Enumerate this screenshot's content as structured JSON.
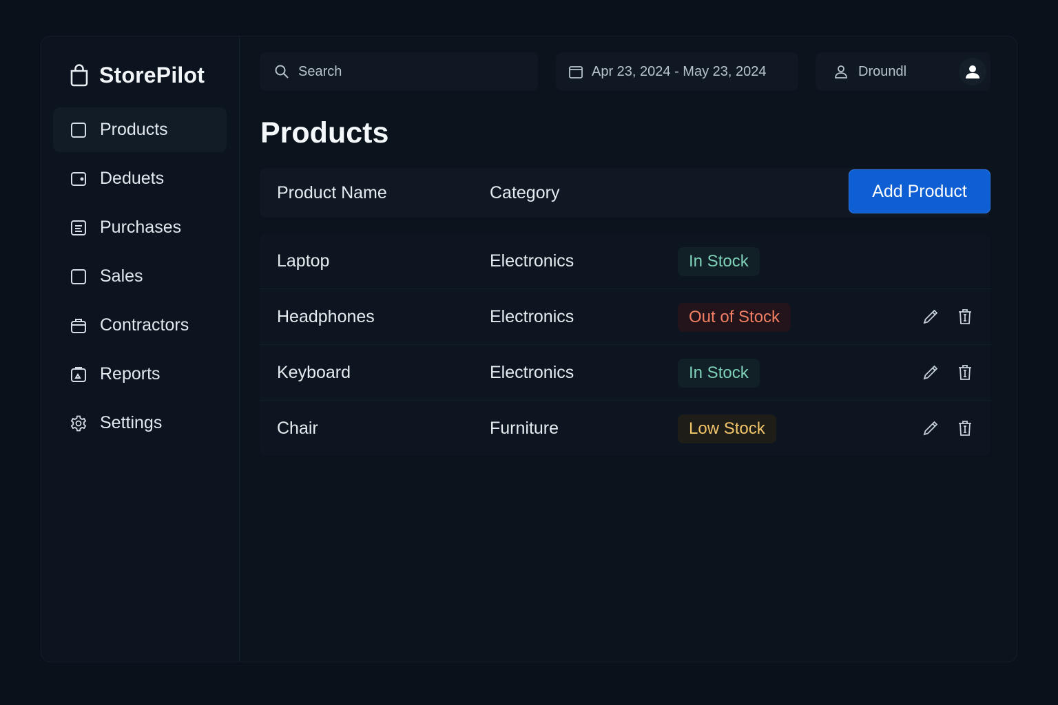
{
  "app": {
    "name": "StorePilot"
  },
  "sidebar": {
    "items": [
      {
        "label": "Products",
        "icon": "square-icon",
        "active": true
      },
      {
        "label": "Deduets",
        "icon": "wallet-icon",
        "active": false
      },
      {
        "label": "Purchases",
        "icon": "receipt-icon",
        "active": false
      },
      {
        "label": "Sales",
        "icon": "square-icon",
        "active": false
      },
      {
        "label": "Contractors",
        "icon": "briefcase-icon",
        "active": false
      },
      {
        "label": "Reports",
        "icon": "clipboard-icon",
        "active": false
      },
      {
        "label": "Settings",
        "icon": "gear-icon",
        "active": false
      }
    ]
  },
  "topbar": {
    "search_placeholder": "Search",
    "date_range": "Apr 23, 2024 - May 23, 2024",
    "user_name": "Droundl"
  },
  "main": {
    "title": "Products",
    "columns": {
      "name": "Product Name",
      "category": "Category"
    },
    "add_button": "Add Product",
    "rows": [
      {
        "name": "Laptop",
        "category": "Electronics",
        "status": "In Stock",
        "status_type": "instock",
        "actions": false
      },
      {
        "name": "Headphones",
        "category": "Electronics",
        "status": "Out of Stock",
        "status_type": "outstock",
        "actions": true
      },
      {
        "name": "Keyboard",
        "category": "Electronics",
        "status": "In Stock",
        "status_type": "instock",
        "actions": true
      },
      {
        "name": "Chair",
        "category": "Furniture",
        "status": "Low Stock",
        "status_type": "lowstock",
        "actions": true
      }
    ]
  },
  "colors": {
    "accent": "#0f5fd4",
    "in_stock": "#7fd1b9",
    "out_of_stock": "#f27f64",
    "low_stock": "#f2c56b"
  }
}
